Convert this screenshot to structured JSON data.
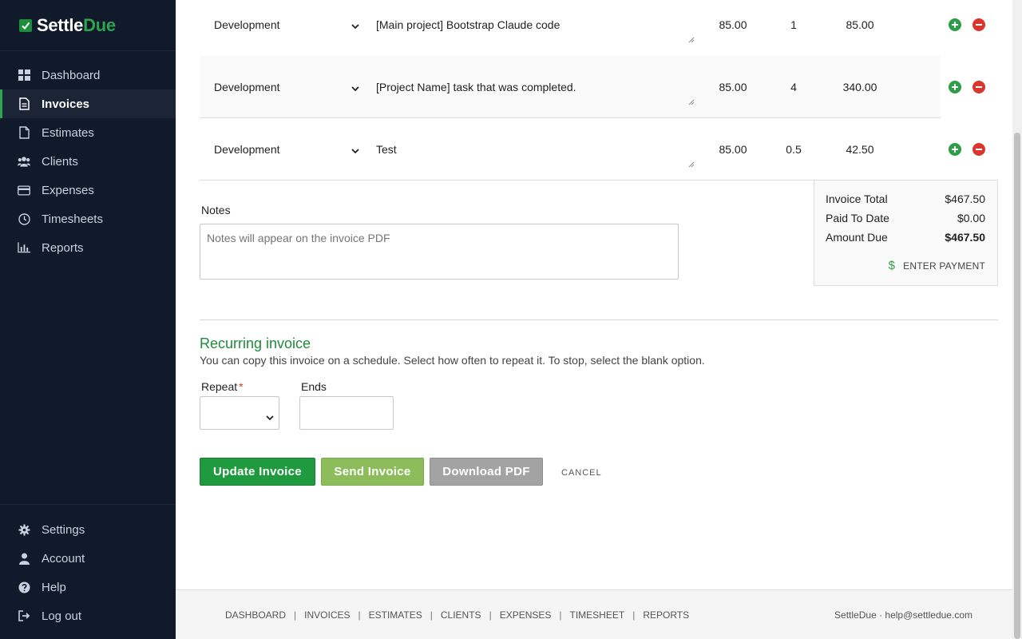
{
  "brand": {
    "name_part1": "Settle",
    "name_part2": "Due"
  },
  "sidebar": {
    "items": [
      {
        "label": "Dashboard",
        "icon": "dashboard-icon"
      },
      {
        "label": "Invoices",
        "icon": "invoice-icon",
        "active": true
      },
      {
        "label": "Estimates",
        "icon": "estimate-icon"
      },
      {
        "label": "Clients",
        "icon": "clients-icon"
      },
      {
        "label": "Expenses",
        "icon": "card-icon"
      },
      {
        "label": "Timesheets",
        "icon": "clock-icon"
      },
      {
        "label": "Reports",
        "icon": "chart-icon"
      }
    ],
    "bottom_items": [
      {
        "label": "Settings",
        "icon": "gear-icon"
      },
      {
        "label": "Account",
        "icon": "user-icon"
      },
      {
        "label": "Help",
        "icon": "question-icon"
      },
      {
        "label": "Log out",
        "icon": "logout-icon"
      }
    ]
  },
  "line_items": [
    {
      "category": "Development",
      "description": "[Main project] Bootstrap Claude code",
      "rate": "85.00",
      "qty": "1",
      "amount": "85.00"
    },
    {
      "category": "Development",
      "description": "[Project Name] task that was completed.",
      "rate": "85.00",
      "qty": "4",
      "amount": "340.00"
    },
    {
      "category": "Development",
      "description": "Test",
      "rate": "85.00",
      "qty": "0.5",
      "amount": "42.50"
    }
  ],
  "notes": {
    "label": "Notes",
    "placeholder": "Notes will appear on the invoice PDF"
  },
  "totals": {
    "invoice_total_label": "Invoice Total",
    "invoice_total": "$467.50",
    "paid_label": "Paid To Date",
    "paid": "$0.00",
    "due_label": "Amount Due",
    "due": "$467.50",
    "enter_payment_icon": "$",
    "enter_payment": "ENTER PAYMENT"
  },
  "recurring": {
    "title": "Recurring invoice",
    "help": "You can copy this invoice on a schedule. Select how often to repeat it. To stop, select the blank option.",
    "repeat_label": "Repeat",
    "required_mark": "*",
    "repeat_value": "",
    "ends_label": "Ends",
    "ends_value": ""
  },
  "actions": {
    "update": "Update Invoice",
    "send": "Send Invoice",
    "pdf": "Download PDF",
    "cancel": "CANCEL"
  },
  "footer": {
    "links": [
      "DASHBOARD",
      "INVOICES",
      "ESTIMATES",
      "CLIENTS",
      "EXPENSES",
      "TIMESHEET",
      "REPORTS"
    ],
    "separator": "|",
    "right_text": "SettleDue · help@settledue.com"
  },
  "colors": {
    "sidebar_bg": "#111a2b",
    "brand_green": "#2ea44f",
    "update_button": "#1f9a3f",
    "send_button": "#8cbd5a",
    "pdf_button": "#a3a3a3",
    "add_icon": "#2e9e46",
    "remove_icon": "#d9372e"
  }
}
